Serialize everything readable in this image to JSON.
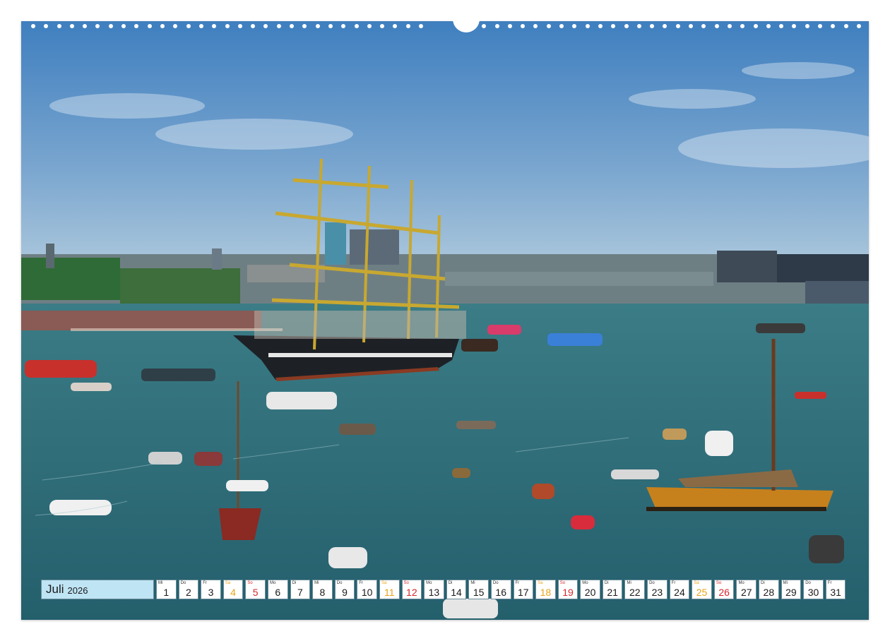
{
  "calendar": {
    "month": "Juli",
    "year": "2026",
    "days": [
      {
        "wd": "Mi",
        "num": "1",
        "type": "weekday"
      },
      {
        "wd": "Do",
        "num": "2",
        "type": "weekday"
      },
      {
        "wd": "Fr",
        "num": "3",
        "type": "weekday"
      },
      {
        "wd": "Sa",
        "num": "4",
        "type": "sat"
      },
      {
        "wd": "So",
        "num": "5",
        "type": "sun"
      },
      {
        "wd": "Mo",
        "num": "6",
        "type": "weekday"
      },
      {
        "wd": "Di",
        "num": "7",
        "type": "weekday"
      },
      {
        "wd": "Mi",
        "num": "8",
        "type": "weekday"
      },
      {
        "wd": "Do",
        "num": "9",
        "type": "weekday"
      },
      {
        "wd": "Fr",
        "num": "10",
        "type": "weekday"
      },
      {
        "wd": "Sa",
        "num": "11",
        "type": "sat"
      },
      {
        "wd": "So",
        "num": "12",
        "type": "sun"
      },
      {
        "wd": "Mo",
        "num": "13",
        "type": "weekday"
      },
      {
        "wd": "Di",
        "num": "14",
        "type": "weekday"
      },
      {
        "wd": "Mi",
        "num": "15",
        "type": "weekday"
      },
      {
        "wd": "Do",
        "num": "16",
        "type": "weekday"
      },
      {
        "wd": "Fr",
        "num": "17",
        "type": "weekday"
      },
      {
        "wd": "Sa",
        "num": "18",
        "type": "sat"
      },
      {
        "wd": "So",
        "num": "19",
        "type": "sun"
      },
      {
        "wd": "Mo",
        "num": "20",
        "type": "weekday"
      },
      {
        "wd": "Di",
        "num": "21",
        "type": "weekday"
      },
      {
        "wd": "Mi",
        "num": "22",
        "type": "weekday"
      },
      {
        "wd": "Do",
        "num": "23",
        "type": "weekday"
      },
      {
        "wd": "Fr",
        "num": "24",
        "type": "weekday"
      },
      {
        "wd": "Sa",
        "num": "25",
        "type": "sat"
      },
      {
        "wd": "So",
        "num": "26",
        "type": "sun"
      },
      {
        "wd": "Mo",
        "num": "27",
        "type": "weekday"
      },
      {
        "wd": "Di",
        "num": "28",
        "type": "weekday"
      },
      {
        "wd": "Mi",
        "num": "29",
        "type": "weekday"
      },
      {
        "wd": "Do",
        "num": "30",
        "type": "weekday"
      },
      {
        "wd": "Fr",
        "num": "31",
        "type": "weekday"
      }
    ]
  },
  "colors": {
    "sky_top": "#3f7fbf",
    "sky_bottom": "#a9c6dc",
    "water": "#2e6f7c",
    "month_bar": "#bfe4f4",
    "saturday": "#e8a317",
    "sunday": "#d8262c"
  }
}
